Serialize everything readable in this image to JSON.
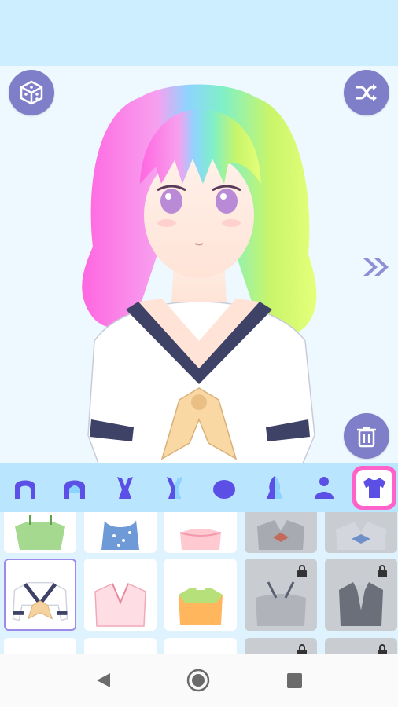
{
  "app": {
    "accent": "#7f7ec9",
    "topbar_color": "#cdeefe",
    "tab_highlight": "#ff63c9"
  },
  "toolbar": {
    "randomize_icon": "dice-icon",
    "shuffle_icon": "shuffle-icon",
    "next_icon": "double-chevron-right-icon",
    "delete_icon": "trash-icon"
  },
  "categories": [
    {
      "name": "back-hair",
      "icon": "back-hair-icon"
    },
    {
      "name": "front-hair",
      "icon": "front-hair-icon"
    },
    {
      "name": "ears",
      "icon": "bunny-ears-icon"
    },
    {
      "name": "ears-alt",
      "icon": "bunny-ears-alt-icon"
    },
    {
      "name": "hat",
      "icon": "hat-icon"
    },
    {
      "name": "hair-color",
      "icon": "hair-color-icon"
    },
    {
      "name": "body",
      "icon": "body-icon"
    },
    {
      "name": "tops",
      "icon": "shirt-icon",
      "selected": true
    }
  ],
  "items": {
    "selected_index": 5,
    "list": [
      {
        "name": "green-top",
        "locked": false
      },
      {
        "name": "blue-dot-dress",
        "locked": false
      },
      {
        "name": "pink-ruffle-top",
        "locked": false
      },
      {
        "name": "grey-blouse-bow",
        "locked": true
      },
      {
        "name": "blue-sailor-top",
        "locked": true
      },
      {
        "name": "sailor-uniform",
        "locked": false
      },
      {
        "name": "pink-kimono-top",
        "locked": false
      },
      {
        "name": "orange-frill-top",
        "locked": false
      },
      {
        "name": "grey-offshoulder-top",
        "locked": true
      },
      {
        "name": "dark-vest-top",
        "locked": true
      },
      {
        "name": "partial-item",
        "locked": false
      },
      {
        "name": "partial-item",
        "locked": false
      },
      {
        "name": "partial-item",
        "locked": false
      },
      {
        "name": "partial-item",
        "locked": true
      },
      {
        "name": "partial-item",
        "locked": true
      }
    ]
  }
}
